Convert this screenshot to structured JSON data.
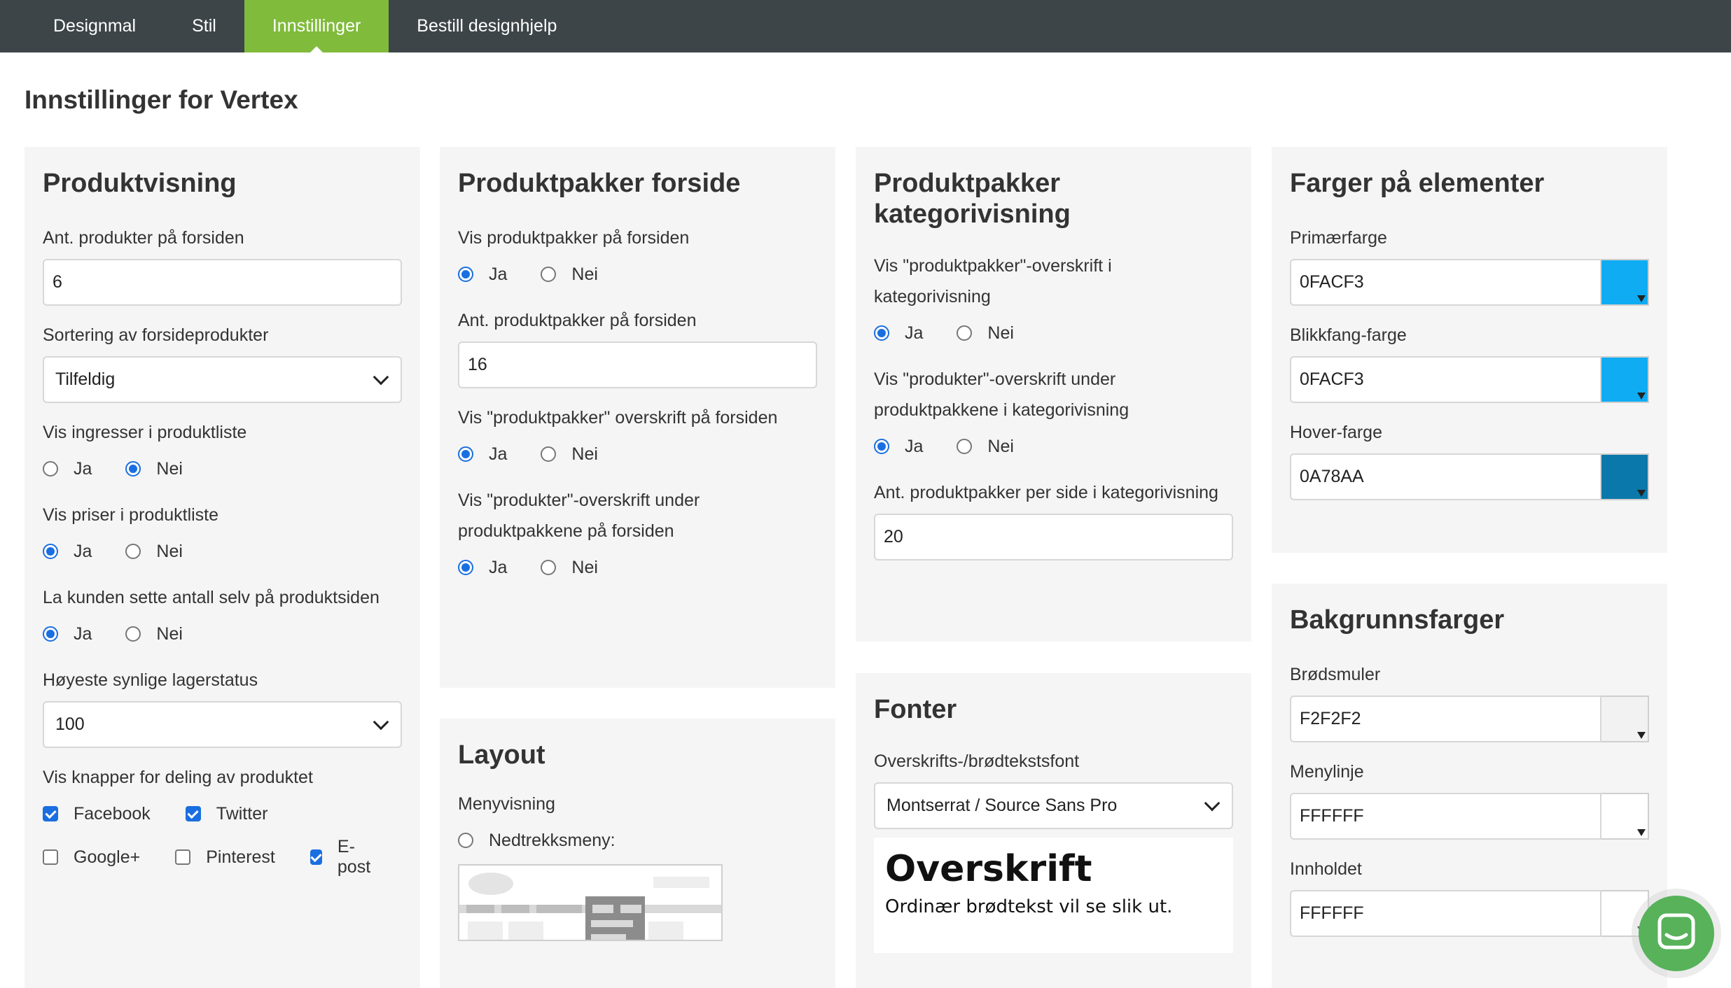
{
  "nav": {
    "tabs": [
      {
        "label": "Designmal"
      },
      {
        "label": "Stil"
      },
      {
        "label": "Innstillinger"
      },
      {
        "label": "Bestill designhjelp"
      }
    ],
    "active_tab": "Innstillinger"
  },
  "page": {
    "title": "Innstillinger for Vertex"
  },
  "produktvisning": {
    "heading": "Produktvisning",
    "ant_label": "Ant. produkter på forsiden",
    "ant_value": "6",
    "sort_label": "Sortering av forsideprodukter",
    "sort_value": "Tilfeldig",
    "ingress_label": "Vis ingresser i produktliste",
    "ingress_selected": "Nei",
    "priser_label": "Vis priser i produktliste",
    "priser_selected": "Ja",
    "antall_label": "La kunden sette antall selv på produktsiden",
    "antall_selected": "Ja",
    "lager_label": "Høyeste synlige lagerstatus",
    "lager_value": "100",
    "deling_label": "Vis knapper for deling av produktet",
    "deling_options": [
      {
        "label": "Facebook",
        "checked": true
      },
      {
        "label": "Twitter",
        "checked": true
      },
      {
        "label": "Google+",
        "checked": false
      },
      {
        "label": "Pinterest",
        "checked": false
      },
      {
        "label": "E-post",
        "checked": true
      }
    ]
  },
  "options": {
    "yes": "Ja",
    "no": "Nei"
  },
  "pakker_forside": {
    "heading": "Produktpakker forside",
    "vis_label": "Vis produktpakker på forsiden",
    "vis_selected": "Ja",
    "ant_label": "Ant. produktpakker på forsiden",
    "ant_value": "16",
    "overskrift_label": "Vis \"produktpakker\" overskrift på forsiden",
    "overskrift_selected": "Ja",
    "produkter_label": "Vis \"produkter\"-overskrift under produktpakkene på forsiden",
    "produkter_selected": "Ja"
  },
  "layout": {
    "heading": "Layout",
    "meny_label": "Menyvisning",
    "option_nedtrekk": "Nedtrekksmeny:"
  },
  "pakker_kategori": {
    "heading": "Produktpakker kategorivisning",
    "overskrift_label": "Vis \"produktpakker\"-overskrift i kategorivisning",
    "overskrift_selected": "Ja",
    "produkter_label": "Vis \"produkter\"-overskrift under produktpakkene i kategorivisning",
    "produkter_selected": "Ja",
    "ant_label": "Ant. produktpakker per side i kategorivisning",
    "ant_value": "20"
  },
  "fonter": {
    "heading": "Fonter",
    "label": "Overskrifts-/brødtekstsfont",
    "value": "Montserrat / Source Sans Pro",
    "preview_heading": "Overskrift",
    "preview_body": "Ordinær brødtekst vil se slik ut."
  },
  "farger": {
    "heading": "Farger på elementer",
    "items": [
      {
        "label": "Primærfarge",
        "value": "0FACF3",
        "color": "#0FACF3"
      },
      {
        "label": "Blikkfang-farge",
        "value": "0FACF3",
        "color": "#0FACF3"
      },
      {
        "label": "Hover-farge",
        "value": "0A78AA",
        "color": "#0A78AA"
      }
    ]
  },
  "bakgrunn": {
    "heading": "Bakgrunnsfarger",
    "items": [
      {
        "label": "Brødsmuler",
        "value": "F2F2F2",
        "color": "#F2F2F2"
      },
      {
        "label": "Menylinje",
        "value": "FFFFFF",
        "color": "#FFFFFF"
      },
      {
        "label": "Innholdet",
        "value": "FFFFFF",
        "color": "#FFFFFF"
      }
    ]
  },
  "colors": {
    "nav_bg": "#3d4549",
    "active_tab": "#80bb3c",
    "radio_blue": "#1a6fe0",
    "chat": "#57b25a"
  }
}
